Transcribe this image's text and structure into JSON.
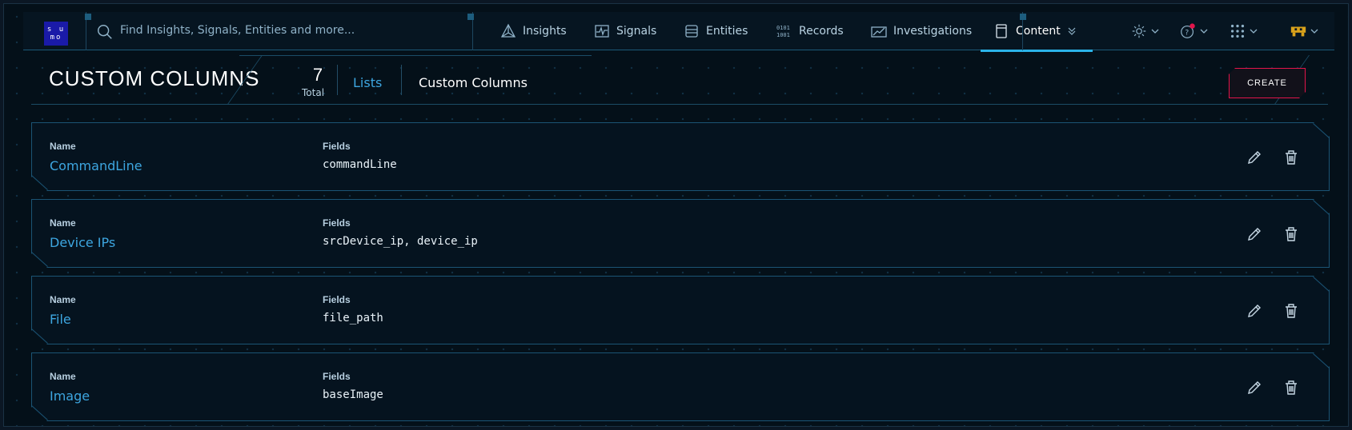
{
  "logo": {
    "line1": "s u",
    "line2": "mo"
  },
  "search": {
    "placeholder": "Find Insights, Signals, Entities and more..."
  },
  "nav": {
    "insights": "Insights",
    "signals": "Signals",
    "entities": "Entities",
    "records": "Records",
    "investigations": "Investigations",
    "content": "Content"
  },
  "header": {
    "title": "CUSTOM COLUMNS",
    "total_count": "7",
    "total_label": "Total",
    "breadcrumb_parent": "Lists",
    "breadcrumb_current": "Custom Columns",
    "create_label": "CREATE"
  },
  "columns": {
    "name_label": "Name",
    "fields_label": "Fields"
  },
  "rows": [
    {
      "name": "CommandLine",
      "fields": "commandLine"
    },
    {
      "name": "Device IPs",
      "fields": "srcDevice_ip, device_ip"
    },
    {
      "name": "File",
      "fields": "file_path"
    },
    {
      "name": "Image",
      "fields": "baseImage"
    }
  ],
  "colors": {
    "accent": "#2bb3e8",
    "link": "#3da6e0",
    "create_border": "#e3154b",
    "notification_dot": "#e3154b",
    "background": "#041019"
  }
}
